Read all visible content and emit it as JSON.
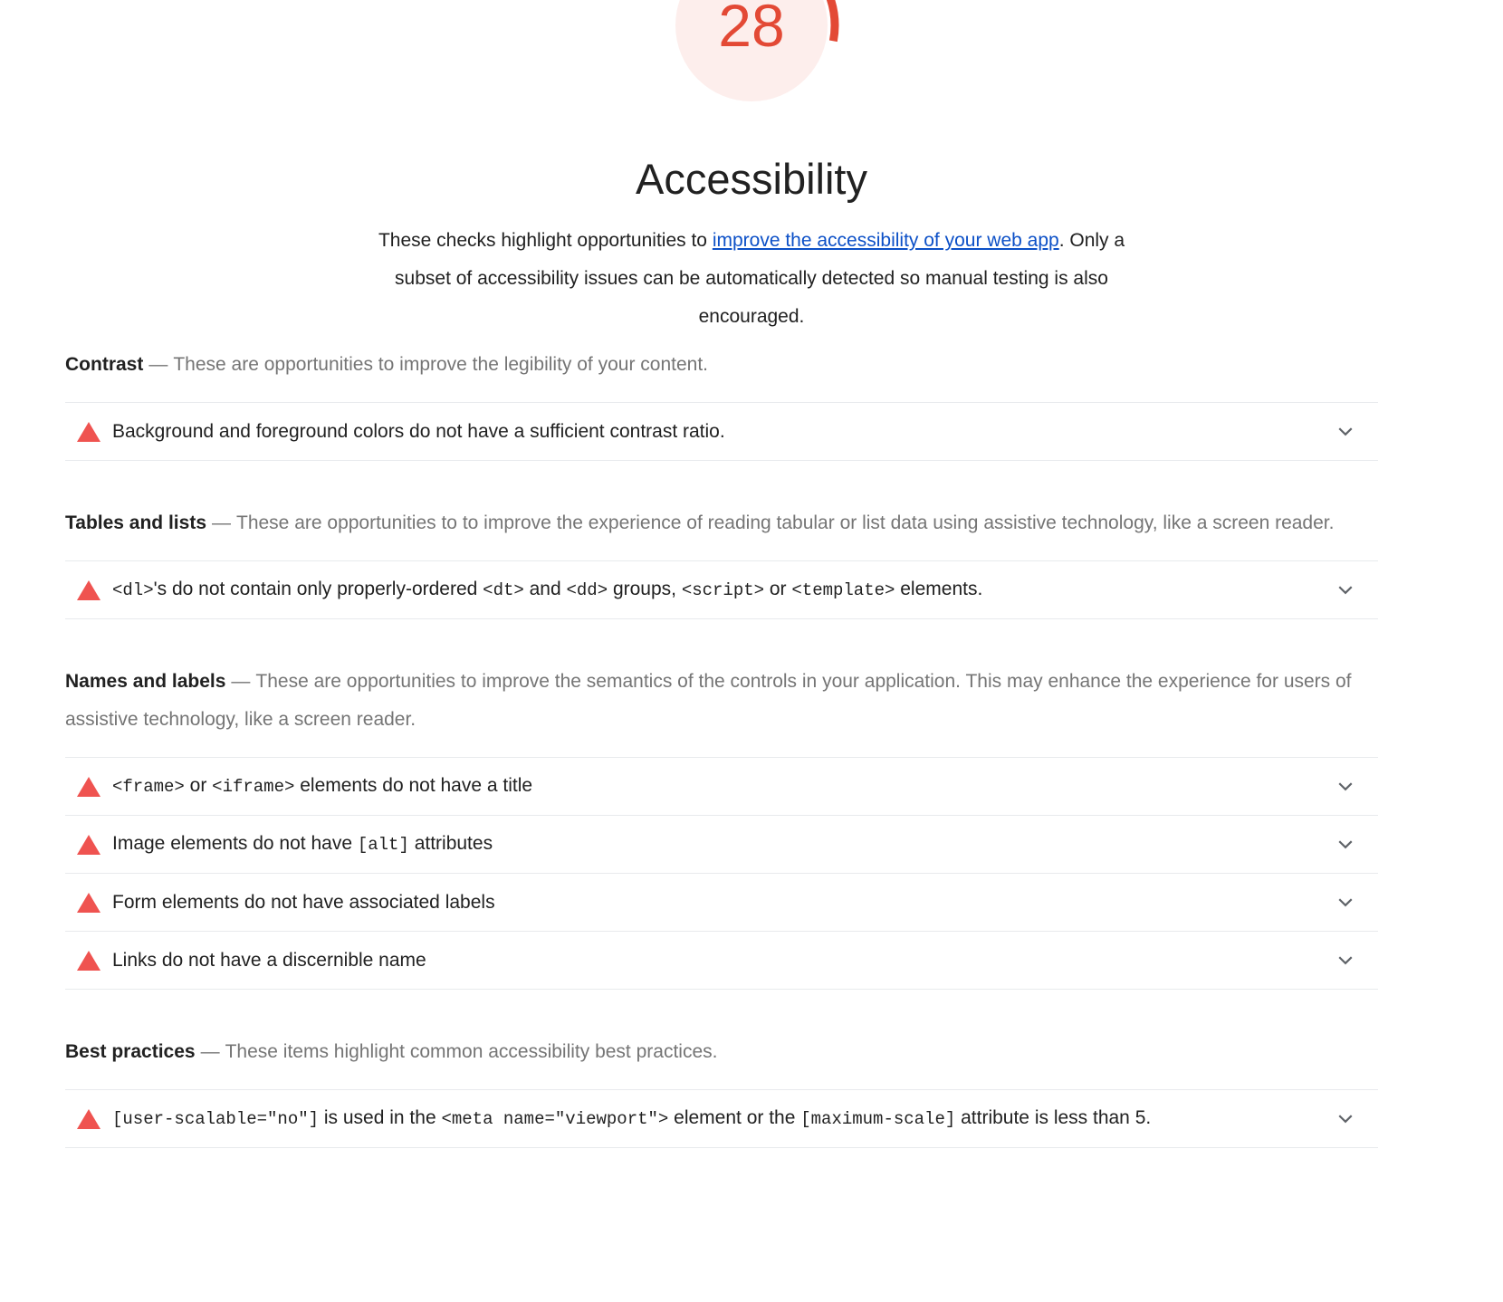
{
  "score": {
    "value": "28",
    "max": 100,
    "color": "#e34935",
    "track_color": "#fdeeec",
    "label": "Accessibility"
  },
  "header": {
    "title": "Accessibility",
    "description_before": "These checks highlight opportunities to ",
    "description_link": "improve the accessibility of your web app",
    "description_after": ". Only a subset of accessibility issues can be automatically detected so manual testing is also encouraged."
  },
  "groups": [
    {
      "title": "Contrast",
      "dash": "—",
      "description": "These are opportunities to improve the legibility of your content.",
      "audits": [
        {
          "icon": "warning-triangle-icon",
          "expand_icon": "chevron-down-icon",
          "parts": [
            {
              "type": "text",
              "value": "Background and foreground colors do not have a sufficient contrast ratio."
            }
          ]
        }
      ]
    },
    {
      "title": "Tables and lists",
      "dash": "—",
      "description": "These are opportunities to to improve the experience of reading tabular or list data using assistive technology, like a screen reader.",
      "audits": [
        {
          "icon": "warning-triangle-icon",
          "expand_icon": "chevron-down-icon",
          "parts": [
            {
              "type": "code",
              "value": "<dl>"
            },
            {
              "type": "text",
              "value": "'s do not contain only properly-ordered "
            },
            {
              "type": "code",
              "value": "<dt>"
            },
            {
              "type": "text",
              "value": " and "
            },
            {
              "type": "code",
              "value": "<dd>"
            },
            {
              "type": "text",
              "value": " groups, "
            },
            {
              "type": "code",
              "value": "<script>"
            },
            {
              "type": "text",
              "value": " or "
            },
            {
              "type": "code",
              "value": "<template>"
            },
            {
              "type": "text",
              "value": " elements."
            }
          ]
        }
      ]
    },
    {
      "title": "Names and labels",
      "dash": "—",
      "description": "These are opportunities to improve the semantics of the controls in your application. This may enhance the experience for users of assistive technology, like a screen reader.",
      "audits": [
        {
          "icon": "warning-triangle-icon",
          "expand_icon": "chevron-down-icon",
          "parts": [
            {
              "type": "code",
              "value": "<frame>"
            },
            {
              "type": "text",
              "value": " or "
            },
            {
              "type": "code",
              "value": "<iframe>"
            },
            {
              "type": "text",
              "value": " elements do not have a title"
            }
          ]
        },
        {
          "icon": "warning-triangle-icon",
          "expand_icon": "chevron-down-icon",
          "parts": [
            {
              "type": "text",
              "value": "Image elements do not have "
            },
            {
              "type": "code",
              "value": "[alt]"
            },
            {
              "type": "text",
              "value": " attributes"
            }
          ]
        },
        {
          "icon": "warning-triangle-icon",
          "expand_icon": "chevron-down-icon",
          "parts": [
            {
              "type": "text",
              "value": "Form elements do not have associated labels"
            }
          ]
        },
        {
          "icon": "warning-triangle-icon",
          "expand_icon": "chevron-down-icon",
          "parts": [
            {
              "type": "text",
              "value": "Links do not have a discernible name"
            }
          ]
        }
      ]
    },
    {
      "title": "Best practices",
      "dash": "—",
      "description": "These items highlight common accessibility best practices.",
      "audits": [
        {
          "icon": "warning-triangle-icon",
          "expand_icon": "chevron-down-icon",
          "parts": [
            {
              "type": "code",
              "value": "[user-scalable=\"no\"]"
            },
            {
              "type": "text",
              "value": " is used in the "
            },
            {
              "type": "code",
              "value": "<meta name=\"viewport\">"
            },
            {
              "type": "text",
              "value": " element or the "
            },
            {
              "type": "code",
              "value": "[maximum-scale]"
            },
            {
              "type": "text",
              "value": " attribute is less than 5."
            }
          ]
        }
      ]
    }
  ]
}
